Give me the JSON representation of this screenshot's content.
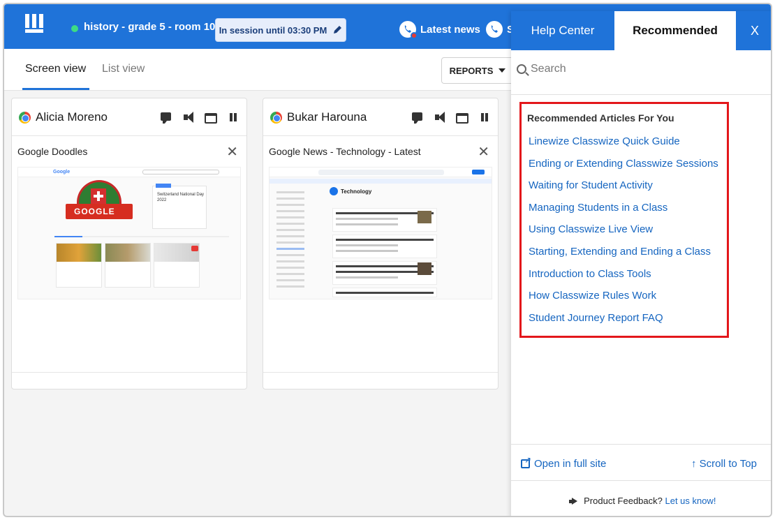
{
  "topbar": {
    "class_name": "history - grade 5 - room 10",
    "session_label": "In session until 03:30 PM",
    "latest_news": "Latest news",
    "truncated_link": "S",
    "brand_color": "#1f73d9",
    "status_color": "#3ddc84"
  },
  "subnav": {
    "tabs": [
      {
        "label": "Screen view",
        "active": true
      },
      {
        "label": "List view",
        "active": false
      }
    ],
    "reports_label": "REPORTS"
  },
  "students": [
    {
      "name": "Alicia Moreno",
      "site_title": "Google Doodles",
      "thumb": {
        "banner": "GOOGLE",
        "panel_title": "Switzerland National Day 2022"
      }
    },
    {
      "name": "Bukar Harouna",
      "site_title": "Google News - Technology - Latest",
      "thumb": {
        "section": "Technology"
      }
    }
  ],
  "help": {
    "tabs": {
      "help_center": "Help Center",
      "recommended": "Recommended",
      "close": "X"
    },
    "search_placeholder": "Search",
    "recommended_heading": "Recommended Articles For You",
    "articles": [
      "Linewize Classwize Quick Guide",
      "Ending or Extending Classwize Sessions",
      "Waiting for Student Activity",
      "Managing Students in a Class",
      "Using Classwize Live View",
      "Starting, Extending and Ending a Class",
      "Introduction to Class Tools",
      "How Classwize Rules Work",
      "Student Journey Report FAQ"
    ],
    "open_full_site": "Open in full site",
    "scroll_to_top": "↑ Scroll to Top",
    "feedback_prefix": "Product Feedback?",
    "feedback_link": "Let us know!",
    "highlight_color": "#e3171b",
    "link_color": "#1565c0"
  }
}
